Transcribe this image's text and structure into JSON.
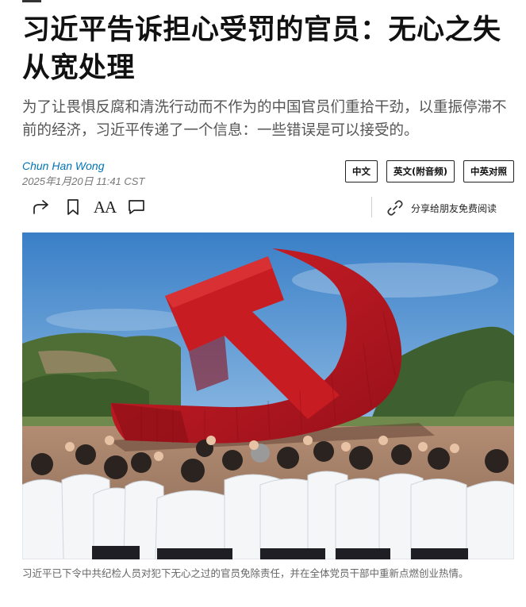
{
  "article": {
    "headline": "习近平告诉担心受罚的官员：无心之失从宽处理",
    "dek": "为了让畏惧反腐和清洗行动而不作为的中国官员们重拾干劲，以重振停滞不前的经济，习近平传递了一个信息：一些错误是可以接受的。",
    "author": "Chun Han Wong",
    "date": "2025年1月20日 11:41 CST"
  },
  "language_buttons": [
    "中文",
    "英文(附音频)",
    "中英对照"
  ],
  "toolbar": {
    "icons": [
      "share-icon",
      "bookmark-icon",
      "text-size-icon",
      "comment-icon",
      "link-icon"
    ],
    "text_size_label": "AA",
    "gift_label": "分享给朋友免费阅读"
  },
  "photo": {
    "caption": "习近平已下令中共纪检人员对犯下无心之过的官员免除责任，并在全体党员干部中重新点燃创业热情。"
  },
  "colors": {
    "author": "#0274b6",
    "dek": "#555555",
    "caption": "#666666",
    "emblem": "#c4161c"
  }
}
